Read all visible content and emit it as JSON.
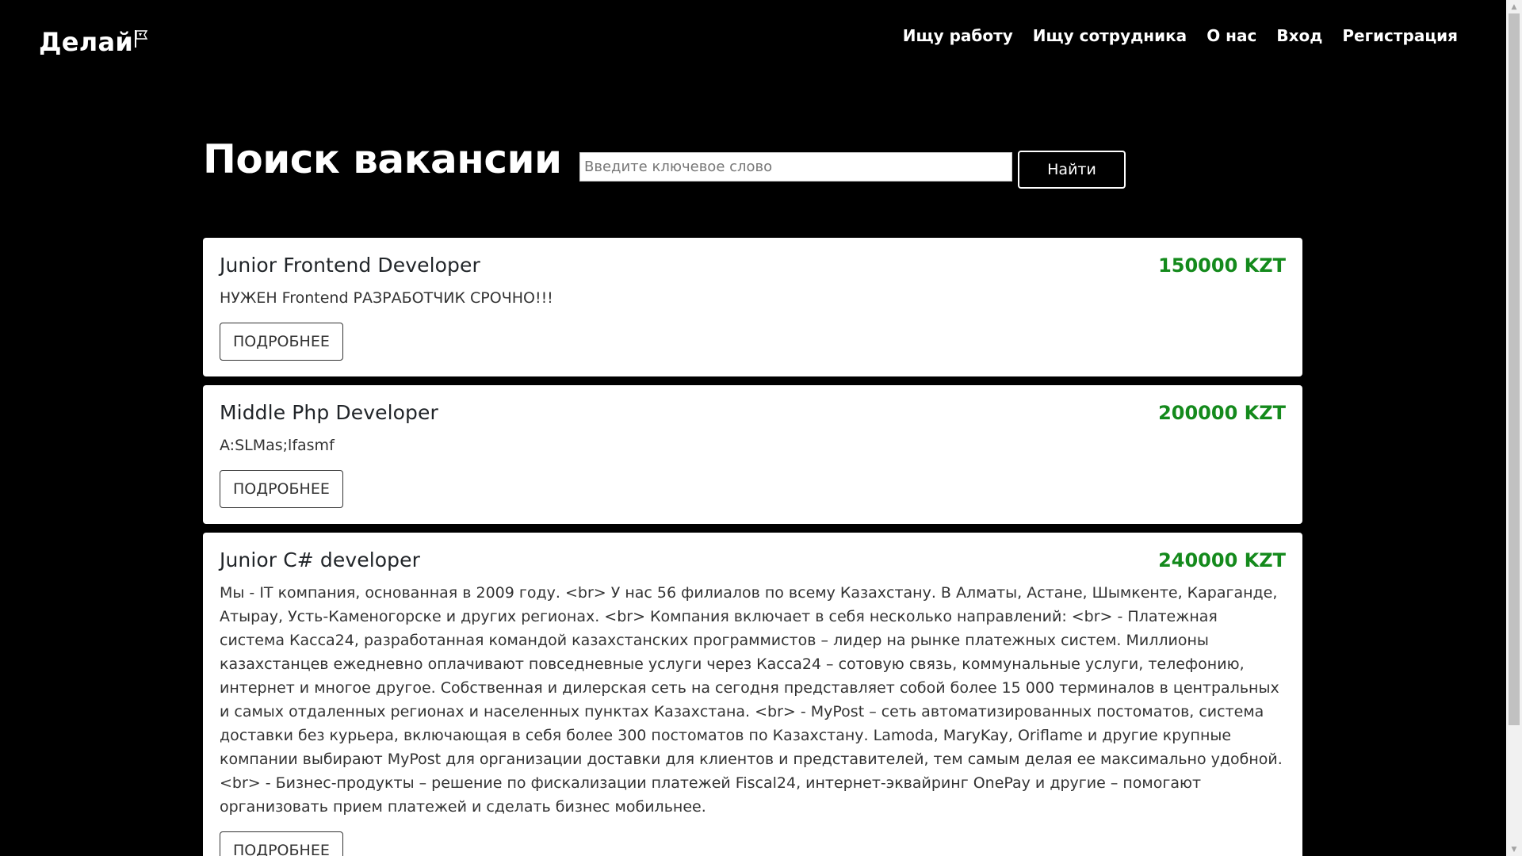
{
  "header": {
    "logo_text": "Делай",
    "logo_icon": "flag-icon",
    "nav": [
      {
        "label": "Ищу работу"
      },
      {
        "label": "Ищу сотрудника"
      },
      {
        "label": "О нас"
      },
      {
        "label": "Вход"
      },
      {
        "label": "Регистрация"
      }
    ]
  },
  "search": {
    "title": "Поиск вакансии",
    "placeholder": "Введите ключевое слово",
    "value": "",
    "button_label": "Найти"
  },
  "vacancies": [
    {
      "title": "Junior Frontend Developer",
      "salary": "150000 KZT",
      "description": "НУЖЕН Frontend РАЗРАБОТЧИК СРОЧНО!!!",
      "button_label": "ПОДРОБНЕЕ"
    },
    {
      "title": "Middle Php Developer",
      "salary": "200000 KZT",
      "description": "A:SLMas;lfasmf",
      "button_label": "ПОДРОБНЕЕ"
    },
    {
      "title": "Junior C# developer",
      "salary": "240000 KZT",
      "description": "Мы - IT компания, основанная в 2009 году. <br> У нас 56 филиалов по всему Казахстану. В Алматы, Астане, Шымкенте, Караганде, Атырау, Усть-Каменогорске и других регионах. <br> Компания включает в себя несколько направлений: <br> - Платежная система Касса24, разработанная командой казахстанских программистов – лидер на рынке платежных систем. Миллионы казахстанцев ежедневно оплачивают повседневные услуги через Касса24 – сотовую связь, коммунальные услуги, телефонию, интернет и многое другое. Собственная и дилерская сеть на сегодня представляет собой более 15 000 терминалов в центральных и самых отдаленных регионах и населенных пунктах Казахстана. <br> - MyPost – сеть автоматизированных постоматов, система доставки без курьера, включающая в себя более 300 постоматов по Казахстану. Lamoda, MaryKay, Oriflame и другие крупные компании выбирают MyPost для организации доставки для клиентов и представителей, тем самым делая ее максимально удобной. <br> - Бизнес-продукты – решение по фискализации платежей Fiscal24, интернет-эквайринг OnePay и другие – помогают организовать прием платежей и сделать бизнес мобильнее.",
      "button_label": "ПОДРОБНЕЕ"
    }
  ],
  "colors": {
    "background": "#000000",
    "card": "#ffffff",
    "salary": "#148a1c"
  }
}
